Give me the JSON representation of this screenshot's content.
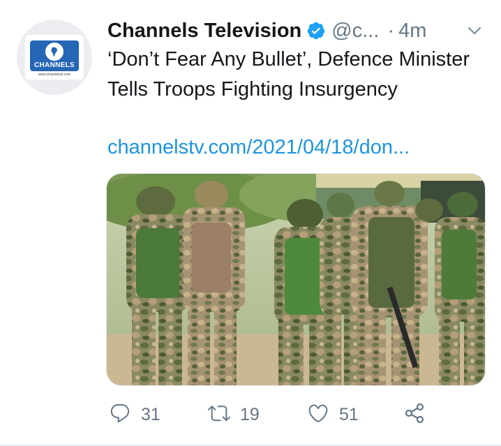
{
  "tweet": {
    "author": {
      "display_name": "Channels Television",
      "handle": "@c...",
      "avatar_logo_text": "CHANNELS",
      "avatar_logo_url": "www.channelstv.com"
    },
    "separator": "·",
    "timestamp": "4m",
    "text": "‘Don’t Fear Any Bullet’, Defence Minister Tells Troops Fighting Insurgency",
    "link_text": "channelstv.com/2021/04/18/don...",
    "actions": {
      "reply_count": "31",
      "retweet_count": "19",
      "like_count": "51"
    }
  },
  "colors": {
    "link": "#1b95e0",
    "verified": "#1da1f2",
    "secondary_text": "#657786",
    "primary_text": "#14171a",
    "brand_blue": "#2566b5"
  },
  "icons": {
    "verified": "verified-badge-icon",
    "menu": "chevron-down-icon",
    "reply": "reply-icon",
    "retweet": "retweet-icon",
    "like": "heart-icon",
    "share": "share-icon"
  }
}
